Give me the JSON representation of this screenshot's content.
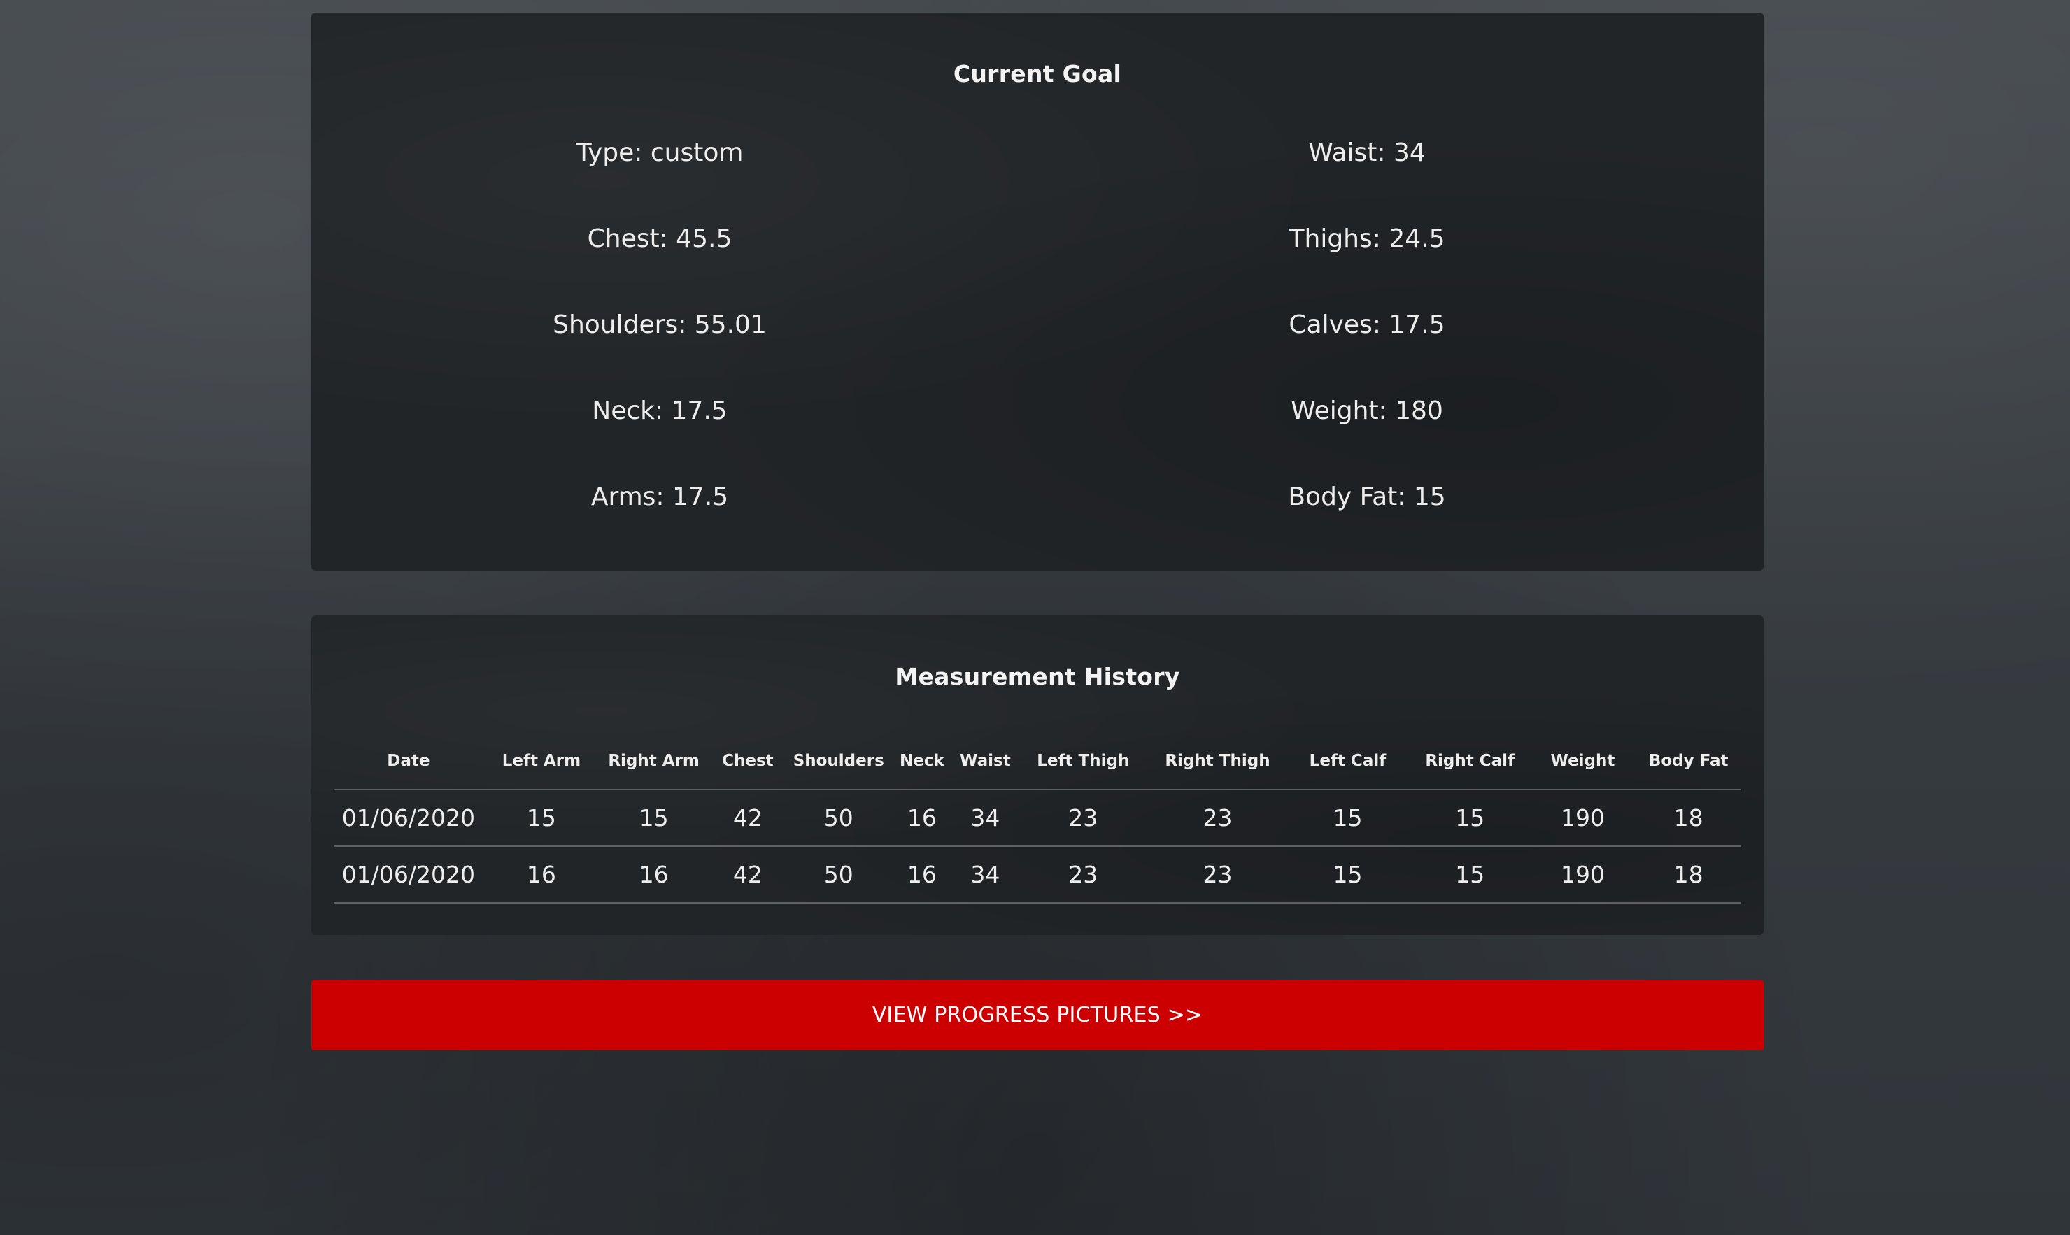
{
  "goal": {
    "title": "Current Goal",
    "rows": [
      {
        "left": "Type: custom",
        "right": "Waist: 34"
      },
      {
        "left": "Chest: 45.5",
        "right": "Thighs: 24.5"
      },
      {
        "left": "Shoulders: 55.01",
        "right": "Calves: 17.5"
      },
      {
        "left": "Neck: 17.5",
        "right": "Weight: 180"
      },
      {
        "left": "Arms: 17.5",
        "right": "Body Fat: 15"
      }
    ]
  },
  "history": {
    "title": "Measurement History",
    "columns": [
      "Date",
      "Left Arm",
      "Right Arm",
      "Chest",
      "Shoulders",
      "Neck",
      "Waist",
      "Left Thigh",
      "Right Thigh",
      "Left Calf",
      "Right Calf",
      "Weight",
      "Body Fat"
    ],
    "rows": [
      [
        "01/06/2020",
        "15",
        "15",
        "42",
        "50",
        "16",
        "34",
        "23",
        "23",
        "15",
        "15",
        "190",
        "18"
      ],
      [
        "01/06/2020",
        "16",
        "16",
        "42",
        "50",
        "16",
        "34",
        "23",
        "23",
        "15",
        "15",
        "190",
        "18"
      ]
    ]
  },
  "actions": {
    "progress_button_label": "VIEW PROGRESS PICTURES >>"
  },
  "colors": {
    "background": "#3a3f44",
    "panel": "#222528",
    "accent_button": "#cc0000"
  }
}
